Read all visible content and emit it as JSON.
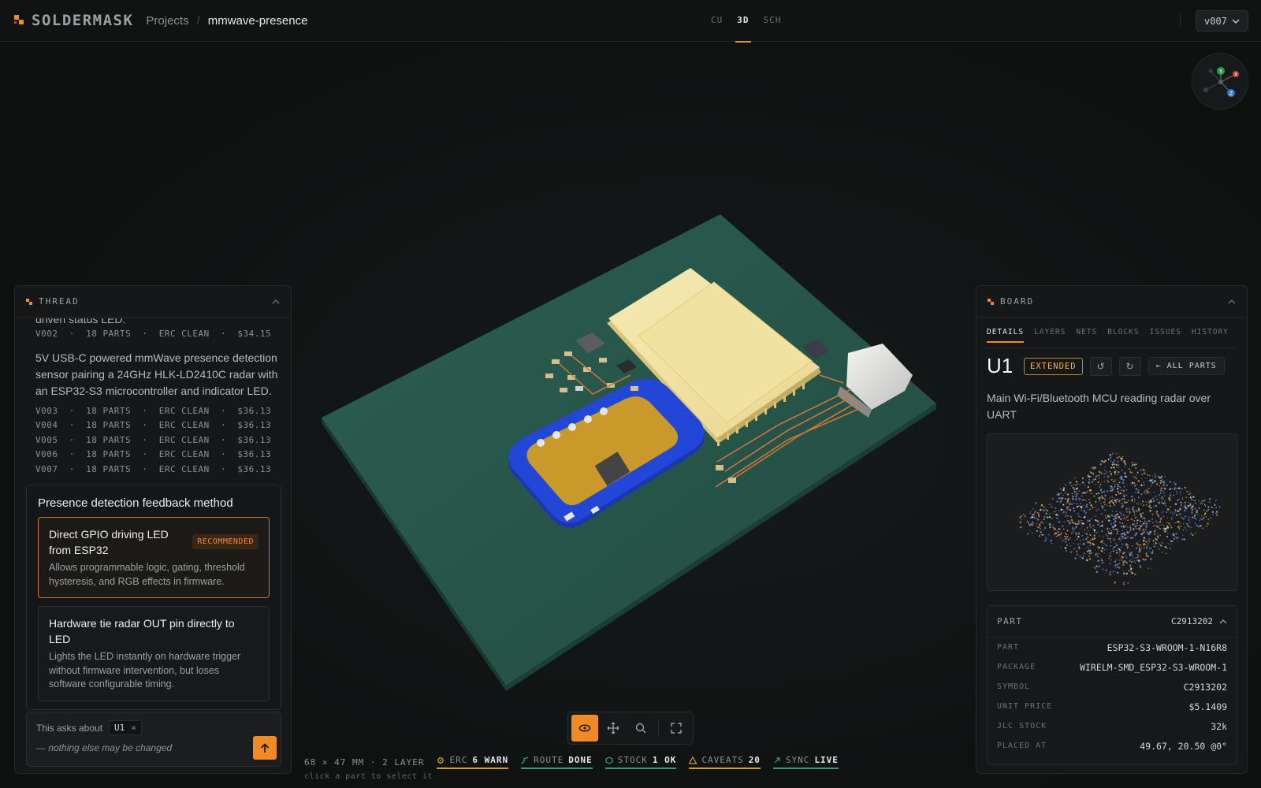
{
  "header": {
    "logo_text": "SOLDERMASK",
    "breadcrumb_projects": "Projects",
    "breadcrumb_sep": "/",
    "project_name": "mmwave-presence",
    "view_tabs": [
      {
        "label": "CU"
      },
      {
        "label": "3D"
      },
      {
        "label": "SCH"
      }
    ],
    "active_view": "3D",
    "version": "v007"
  },
  "gizmo": {
    "x": "X",
    "y": "Y",
    "z": "Z"
  },
  "thread": {
    "title": "THREAD",
    "cut_text": "driven status LED.",
    "version_v002": "V002  ·  18 PARTS  ·  ERC CLEAN  ·  $34.15",
    "description": "5V USB-C powered mmWave presence detection sensor pairing a 24GHz HLK-LD2410C radar with an ESP32-S3 microcontroller and indicator LED.",
    "versions": [
      "V003  ·  18 PARTS  ·  ERC CLEAN  ·  $36.13",
      "V004  ·  18 PARTS  ·  ERC CLEAN  ·  $36.13",
      "V005  ·  18 PARTS  ·  ERC CLEAN  ·  $36.13",
      "V006  ·  18 PARTS  ·  ERC CLEAN  ·  $36.13",
      "V007  ·  18 PARTS  ·  ERC CLEAN  ·  $36.13"
    ],
    "question": {
      "title": "Presence detection feedback method",
      "options": [
        {
          "title": "Direct GPIO driving LED from ESP32",
          "badge": "RECOMMENDED",
          "description": "Allows programmable logic, gating, threshold hysteresis, and RGB effects in firmware."
        },
        {
          "title": "Hardware tie radar OUT pin directly to LED",
          "description": "Lights the LED instantly on hardware trigger without firmware intervention, but loses software configurable timing."
        }
      ]
    },
    "composer": {
      "context_label": "This asks about",
      "chip": "U1",
      "chip_close": "×",
      "hint": "— nothing else may be changed"
    }
  },
  "board_panel": {
    "title": "BOARD",
    "tabs": [
      "DETAILS",
      "LAYERS",
      "NETS",
      "BLOCKS",
      "ISSUES",
      "HISTORY"
    ],
    "active_tab": "DETAILS",
    "ref": "U1",
    "badge": "EXTENDED",
    "undo": "↺",
    "redo": "↻",
    "all_parts": "← ALL PARTS",
    "description": "Main Wi-Fi/Bluetooth MCU reading radar over UART",
    "spec_header": {
      "label": "PART",
      "value": "C2913202"
    },
    "specs": [
      {
        "k": "PART",
        "v": "ESP32-S3-WROOM-1-N16R8"
      },
      {
        "k": "PACKAGE",
        "v": "WIRELM-SMD_ESP32-S3-WROOM-1"
      },
      {
        "k": "SYMBOL",
        "v": "C2913202"
      },
      {
        "k": "UNIT PRICE",
        "v": "$5.1409"
      },
      {
        "k": "JLC STOCK",
        "v": "32k"
      },
      {
        "k": "PLACED AT",
        "v": "49.67, 20.50 @0°"
      }
    ]
  },
  "toolbar": {
    "tools": [
      "orbit-tool",
      "pan-tool",
      "zoom-tool",
      "fit-tool"
    ],
    "active": "orbit-tool"
  },
  "status": {
    "dims": "68 × 47 MM · 2 LAYER",
    "erc_k": "ERC",
    "erc_v": "6 WARN",
    "route_k": "ROUTE",
    "route_v": "DONE",
    "stock_k": "STOCK",
    "stock_v": "1 OK",
    "caveats_k": "CAVEATS",
    "caveats_v": "20",
    "sync_k": "SYNC",
    "sync_v": "LIVE",
    "hint": "click a part to select it"
  },
  "colors": {
    "accent": "#f08a24",
    "warn": "#d99a2b",
    "ok": "#2fa36b",
    "pcb": "#2a5a4c",
    "radar_module": "#1f3fc4",
    "mcu_module": "#f2e4a6"
  }
}
